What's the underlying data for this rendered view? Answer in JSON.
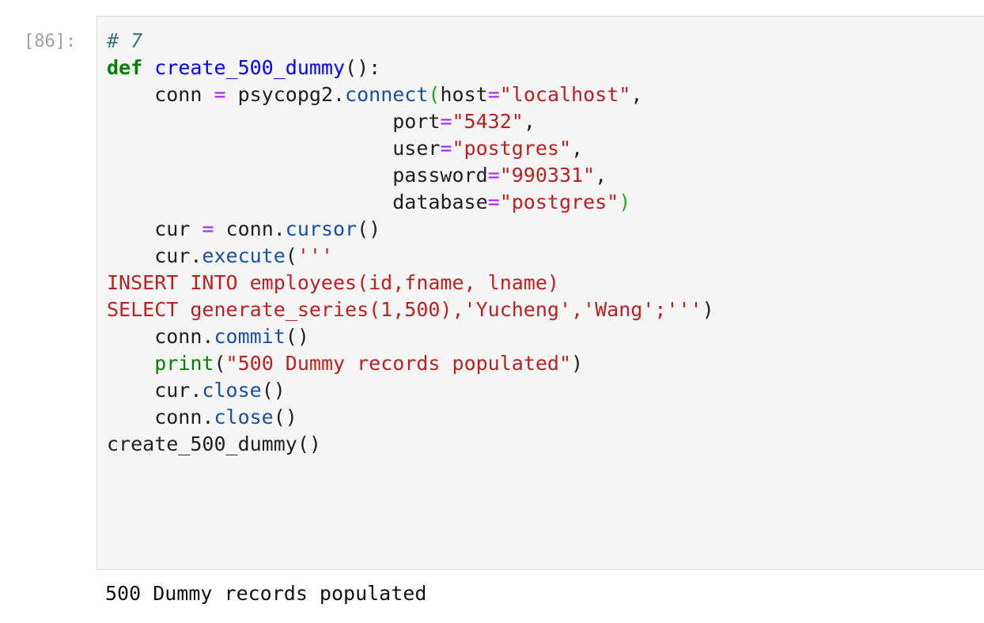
{
  "cell": {
    "prompt": "[86]:",
    "code_lines": [
      [
        {
          "t": "# 7",
          "c": "comment"
        }
      ],
      [
        {
          "t": "def",
          "c": "keyword"
        },
        {
          "t": " ",
          "c": "plain"
        },
        {
          "t": "create_500_dummy",
          "c": "def"
        },
        {
          "t": "():",
          "c": "plain"
        }
      ],
      [
        {
          "t": "    conn ",
          "c": "plain"
        },
        {
          "t": "=",
          "c": "op"
        },
        {
          "t": " psycopg2.",
          "c": "plain"
        },
        {
          "t": "connect",
          "c": "attr"
        },
        {
          "t": "(",
          "c": "paren-match"
        },
        {
          "t": "host",
          "c": "plain"
        },
        {
          "t": "=",
          "c": "op"
        },
        {
          "t": "\"localhost\"",
          "c": "str"
        },
        {
          "t": ",",
          "c": "plain"
        }
      ],
      [
        {
          "t": "                        port",
          "c": "plain"
        },
        {
          "t": "=",
          "c": "op"
        },
        {
          "t": "\"5432\"",
          "c": "str"
        },
        {
          "t": ",",
          "c": "plain"
        }
      ],
      [
        {
          "t": "                        user",
          "c": "plain"
        },
        {
          "t": "=",
          "c": "op"
        },
        {
          "t": "\"postgres\"",
          "c": "str"
        },
        {
          "t": ",",
          "c": "plain"
        }
      ],
      [
        {
          "t": "                        password",
          "c": "plain"
        },
        {
          "t": "=",
          "c": "op"
        },
        {
          "t": "\"990331\"",
          "c": "str"
        },
        {
          "t": ",",
          "c": "plain"
        }
      ],
      [
        {
          "t": "                        database",
          "c": "plain"
        },
        {
          "t": "=",
          "c": "op"
        },
        {
          "t": "\"postgres\"",
          "c": "str"
        },
        {
          "t": ")",
          "c": "paren-match"
        }
      ],
      [
        {
          "t": "    cur ",
          "c": "plain"
        },
        {
          "t": "=",
          "c": "op"
        },
        {
          "t": " conn.",
          "c": "plain"
        },
        {
          "t": "cursor",
          "c": "attr"
        },
        {
          "t": "()",
          "c": "plain"
        }
      ],
      [
        {
          "t": "    cur.",
          "c": "plain"
        },
        {
          "t": "execute",
          "c": "attr"
        },
        {
          "t": "(",
          "c": "plain"
        },
        {
          "t": "'''",
          "c": "str"
        }
      ],
      [
        {
          "t": "INSERT INTO employees(id,fname, lname)",
          "c": "str"
        }
      ],
      [
        {
          "t": "SELECT generate_series(1,500),'Yucheng','Wang';'''",
          "c": "str"
        },
        {
          "t": ")",
          "c": "plain"
        }
      ],
      [
        {
          "t": "    conn.",
          "c": "plain"
        },
        {
          "t": "commit",
          "c": "attr"
        },
        {
          "t": "()",
          "c": "plain"
        }
      ],
      [
        {
          "t": "    ",
          "c": "plain"
        },
        {
          "t": "print",
          "c": "builtin"
        },
        {
          "t": "(",
          "c": "plain"
        },
        {
          "t": "\"500 Dummy records populated\"",
          "c": "str"
        },
        {
          "t": ")",
          "c": "plain"
        }
      ],
      [
        {
          "t": "    cur.",
          "c": "plain"
        },
        {
          "t": "close",
          "c": "attr"
        },
        {
          "t": "()",
          "c": "plain"
        }
      ],
      [
        {
          "t": "    conn.",
          "c": "plain"
        },
        {
          "t": "close",
          "c": "attr"
        },
        {
          "t": "()",
          "c": "plain"
        }
      ],
      [
        {
          "t": "create_500_dummy()",
          "c": "plain"
        }
      ]
    ],
    "output": "500 Dummy records populated"
  },
  "colors": {
    "cell_background": "#f5f5f5",
    "cell_border": "#dadada",
    "prompt": "#a0a0a0",
    "comment": "#3d7a7a",
    "keyword": "#008000",
    "function_name": "#0000ff",
    "attribute": "#1b4fa3",
    "operator": "#aa22ff",
    "string": "#ba2121"
  }
}
